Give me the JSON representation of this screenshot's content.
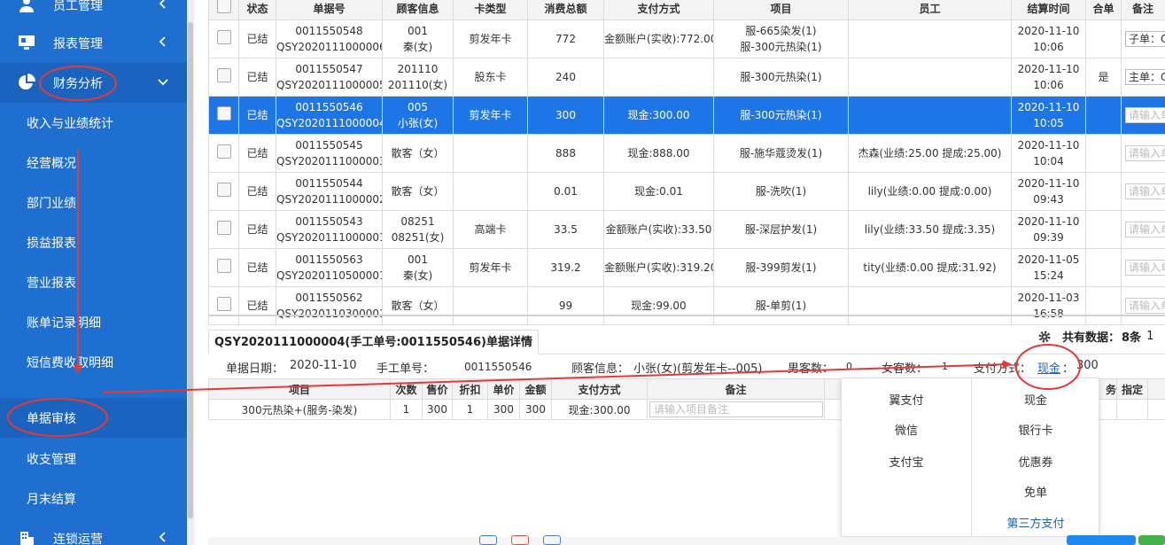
{
  "sidebar": {
    "menus": [
      {
        "label": "员工管理",
        "icon": "user-icon"
      },
      {
        "label": "报表管理",
        "icon": "monitor-icon"
      },
      {
        "label": "财务分析",
        "icon": "pie-chart-icon"
      },
      {
        "label": "连锁运营",
        "icon": "building-icon"
      }
    ],
    "sub_items": [
      {
        "label": "收入与业绩统计"
      },
      {
        "label": "经营概况"
      },
      {
        "label": "部门业绩"
      },
      {
        "label": "损益报表"
      },
      {
        "label": "营业报表"
      },
      {
        "label": "账单记录明细"
      },
      {
        "label": "短信费收取明细"
      },
      {
        "label": "单据审核"
      },
      {
        "label": "收支管理"
      },
      {
        "label": "月末结算"
      }
    ]
  },
  "grid": {
    "columns": [
      "状态",
      "单据号",
      "顾客信息",
      "卡类型",
      "消费总额",
      "支付方式",
      "项目",
      "员工",
      "结算时间",
      "合单",
      "备注"
    ],
    "rows": [
      {
        "status": "已结",
        "no1": "0011550548",
        "no2": "QSY2020111000006",
        "c1": "001",
        "c2": "秦(女)",
        "card": "剪发年卡",
        "total": "772",
        "pay": "金额账户(实收):772.00",
        "item1": "服-665染发(1)",
        "item2": "服-300元热染(1)",
        "staff": "",
        "t1": "2020-11-10",
        "t2": "10:06",
        "merge": "",
        "note": "子单：Q",
        "note_filled": true,
        "selected": false
      },
      {
        "status": "已结",
        "no1": "0011550547",
        "no2": "QSY2020111000005",
        "c1": "201110",
        "c2": "201110(女)",
        "card": "股东卡",
        "total": "240",
        "pay": "",
        "item1": "服-300元热染(1)",
        "item2": "",
        "staff": "",
        "t1": "2020-11-10",
        "t2": "10:06",
        "merge": "是",
        "note": "主单：Q",
        "note_filled": true,
        "selected": false
      },
      {
        "status": "已结",
        "no1": "0011550546",
        "no2": "QSY2020111000004",
        "c1": "005",
        "c2": "小张(女)",
        "card": "剪发年卡",
        "total": "300",
        "pay": "现金:300.00",
        "item1": "服-300元热染(1)",
        "item2": "",
        "staff": "",
        "t1": "2020-11-10",
        "t2": "10:05",
        "merge": "",
        "note": "请输入单",
        "note_filled": false,
        "selected": true
      },
      {
        "status": "已结",
        "no1": "0011550545",
        "no2": "QSY2020111000003",
        "c1": "散客（女）",
        "c2": "",
        "card": "",
        "total": "888",
        "pay": "现金:888.00",
        "item1": "服-施华蔻烫发(1)",
        "item2": "",
        "staff": "杰森(业绩:25.00 提成:25.00)",
        "t1": "2020-11-10",
        "t2": "10:04",
        "merge": "",
        "note": "请输入单",
        "note_filled": false,
        "selected": false
      },
      {
        "status": "已结",
        "no1": "0011550544",
        "no2": "QSY2020111000002",
        "c1": "散客（女）",
        "c2": "",
        "card": "",
        "total": "0.01",
        "pay": "现金:0.01",
        "item1": "服-洗吹(1)",
        "item2": "",
        "staff": "lily(业绩:0.00 提成:0.00)",
        "t1": "2020-11-10",
        "t2": "09:43",
        "merge": "",
        "note": "请输入单",
        "note_filled": false,
        "selected": false
      },
      {
        "status": "已结",
        "no1": "0011550543",
        "no2": "QSY2020111000001",
        "c1": "08251",
        "c2": "08251(女)",
        "card": "高端卡",
        "total": "33.5",
        "pay": "金额账户(实收):33.50",
        "item1": "服-深层护发(1)",
        "item2": "",
        "staff": "lily(业绩:33.50 提成:3.35)",
        "t1": "2020-11-10",
        "t2": "09:39",
        "merge": "",
        "note": "请输入单",
        "note_filled": false,
        "selected": false
      },
      {
        "status": "已结",
        "no1": "0011550563",
        "no2": "QSY2020110500001",
        "c1": "001",
        "c2": "秦(女)",
        "card": "剪发年卡",
        "total": "319.2",
        "pay": "金额账户(实收):319.20",
        "item1": "服-399剪发(1)",
        "item2": "",
        "staff": "tity(业绩:0.00 提成:31.92)",
        "t1": "2020-11-05",
        "t2": "15:24",
        "merge": "",
        "note": "请输入单",
        "note_filled": false,
        "selected": false
      },
      {
        "status": "已结",
        "no1": "0011550562",
        "no2": "QSY2020110300001",
        "c1": "散客（女）",
        "c2": "",
        "card": "",
        "total": "99",
        "pay": "现金:99.00",
        "item1": "服-单剪(1)",
        "item2": "",
        "staff": "",
        "t1": "2020-11-03",
        "t2": "16:58",
        "merge": "",
        "note": "请输入单",
        "note_filled": false,
        "selected": false
      }
    ]
  },
  "detail": {
    "tab_title": "QSY2020111000004(手工单号:0011550546)单据详情",
    "total_label": "共有数据：",
    "total_value": "8条",
    "total_extra": "1",
    "info": {
      "date_label": "单据日期：",
      "date": "2020-11-10",
      "manual_label": "手工单号：",
      "manual": "0011550546",
      "customer_label": "顾客信息：",
      "customer": "小张(女)(剪发年卡--005)",
      "male_label": "男客数：",
      "male": "0",
      "female_label": "女客数：",
      "female": "1",
      "pay_label": "支付方式：",
      "pay_link": "现金",
      "pay_colon": "：",
      "pay_amount": "300"
    },
    "columns": [
      "项目",
      "次数",
      "售价",
      "折扣",
      "单价",
      "金额",
      "支付方式",
      "备注",
      "服务",
      "指定"
    ],
    "extra_col1": "务",
    "row": {
      "item": "300元热染+(服务-染发)",
      "count": "1",
      "price": "300",
      "discount": "1",
      "unit": "300",
      "amount": "300",
      "pay": "现金:300.00",
      "note_placeholder": "请输入项目备注"
    }
  },
  "payment_popup": {
    "left": [
      "翼支付",
      "微信",
      "支付宝"
    ],
    "right": [
      "现金",
      "银行卡",
      "优惠券",
      "免单",
      "第三方支付"
    ]
  },
  "colors": {
    "sidebar": "#1e6fd0",
    "selected_row": "#1e76e6",
    "annotation": "#e53935"
  }
}
